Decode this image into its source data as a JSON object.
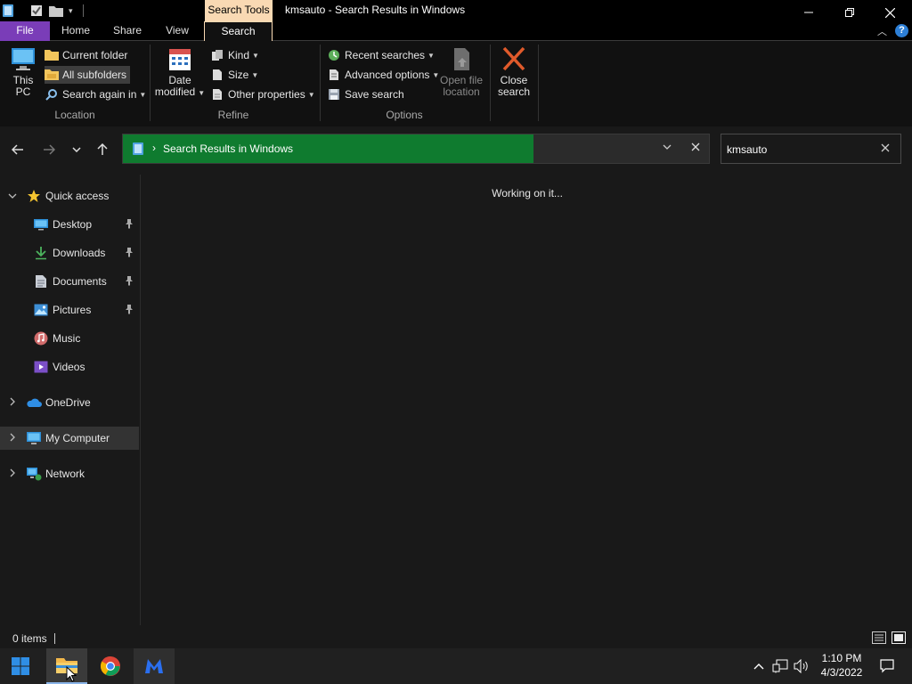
{
  "window": {
    "title": "kmsauto - Search Results in Windows",
    "contextual_tab": "Search Tools"
  },
  "ribbon_tabs": {
    "file": "File",
    "home": "Home",
    "share": "Share",
    "view": "View",
    "search": "Search"
  },
  "ribbon": {
    "location": {
      "label": "Location",
      "this_pc_line1": "This",
      "this_pc_line2": "PC",
      "current_folder": "Current folder",
      "all_subfolders": "All subfolders",
      "search_again_in": "Search again in"
    },
    "refine": {
      "label": "Refine",
      "date_modified_line1": "Date",
      "date_modified_line2": "modified",
      "kind": "Kind",
      "size": "Size",
      "other_properties": "Other properties"
    },
    "options": {
      "label": "Options",
      "recent_searches": "Recent searches",
      "advanced_options": "Advanced options",
      "save_search": "Save search",
      "open_file_location_line1": "Open file",
      "open_file_location_line2": "location",
      "close_search_line1": "Close",
      "close_search_line2": "search"
    }
  },
  "address": {
    "path": "Search Results in Windows",
    "progress": 0.7
  },
  "search": {
    "value": "kmsauto"
  },
  "nav_pane": {
    "quick_access": "Quick access",
    "items": [
      {
        "label": "Desktop",
        "icon": "desktop-icon",
        "pinned": true
      },
      {
        "label": "Downloads",
        "icon": "downloads-icon",
        "pinned": true
      },
      {
        "label": "Documents",
        "icon": "documents-icon",
        "pinned": true
      },
      {
        "label": "Pictures",
        "icon": "pictures-icon",
        "pinned": true
      },
      {
        "label": "Music",
        "icon": "music-icon",
        "pinned": false
      },
      {
        "label": "Videos",
        "icon": "videos-icon",
        "pinned": false
      }
    ],
    "onedrive": "OneDrive",
    "my_computer": "My Computer",
    "network": "Network"
  },
  "content": {
    "status_message": "Working on it..."
  },
  "status_bar": {
    "item_count": "0 items"
  },
  "taskbar": {
    "time": "1:10 PM",
    "date": "4/3/2022"
  },
  "colors": {
    "file_tab": "#7a3db8",
    "search_tools": "#f9d9b3",
    "address_progress": "#0f7b2f",
    "close_search_x": "#e05a2b"
  }
}
